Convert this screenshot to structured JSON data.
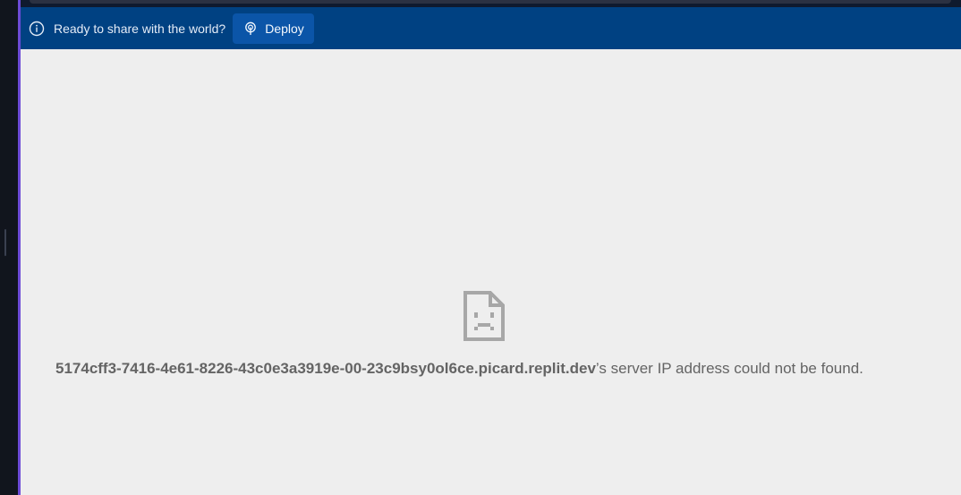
{
  "banner": {
    "message": "Ready to share with the world?",
    "deploy_label": "Deploy",
    "info_icon": "info-icon",
    "deploy_icon": "deploy-icon",
    "background": "#004182",
    "button_color": "#0b55a8"
  },
  "error_page": {
    "icon": "sad-document-icon",
    "hostname": "5174cff3-7416-4e61-8226-43c0e3a3919e-00-23c9bsy0ol6ce.picard.replit.dev",
    "message_suffix": "’s server IP address could not be found.",
    "background": "#eeeeee"
  }
}
